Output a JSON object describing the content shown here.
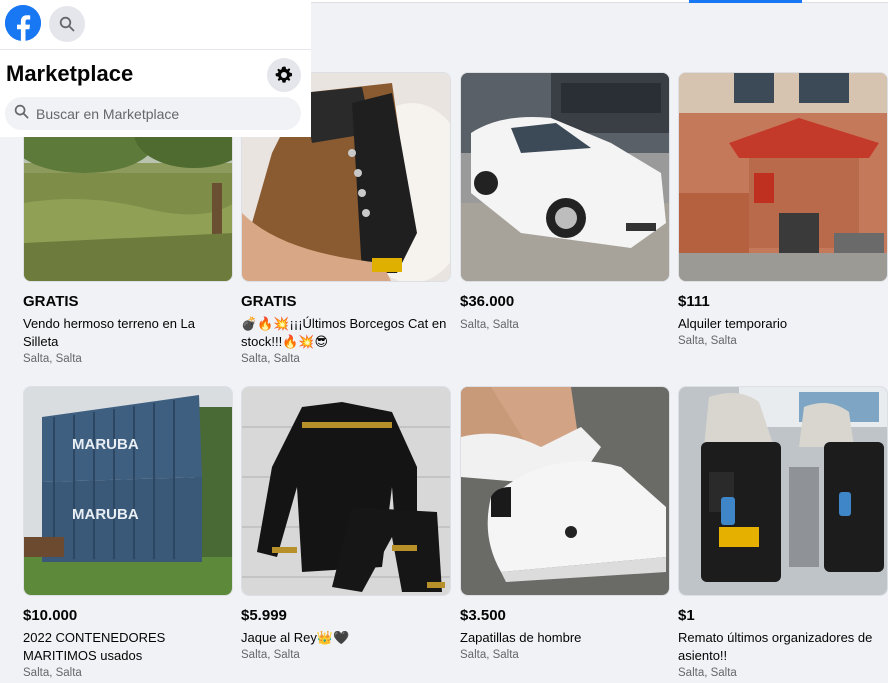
{
  "app": {
    "logo": "facebook-logo",
    "title": "Marketplace",
    "search_placeholder": "Buscar en Marketplace",
    "brand_color": "#1877f2"
  },
  "listings": [
    {
      "price": "GRATIS",
      "title": "Vendo hermoso terreno en La Silleta",
      "location": "Salta, Salta",
      "image": "field-with-trees"
    },
    {
      "price": "GRATIS",
      "title": "💣🔥💥¡¡¡Últimos Borcegos Cat en stock!!!🔥💥😎",
      "location": "Salta, Salta",
      "image": "brown-caterpillar-boot"
    },
    {
      "price": "$36.000",
      "title": "",
      "location": "Salta, Salta",
      "image": "white-pickup-car"
    },
    {
      "price": "$111",
      "title": "Alquiler temporario",
      "location": "Salta, Salta",
      "image": "brick-house-red-roof"
    },
    {
      "price": "$10.000",
      "title": "2022 CONTENEDORES MARITIMOS usados",
      "location": "Salta, Salta",
      "image": "shipping-containers",
      "photo_text": "MARUBA"
    },
    {
      "price": "$5.999",
      "title": "Jaque al Rey👑🖤",
      "location": "Salta, Salta",
      "image": "black-tracksuit"
    },
    {
      "price": "$3.500",
      "title": "Zapatillas de hombre",
      "location": "Salta, Salta",
      "image": "white-sneakers"
    },
    {
      "price": "$1",
      "title": "Remato últimos organizadores de asiento!!",
      "location": "Salta, Salta",
      "image": "car-seat-organizer"
    }
  ]
}
